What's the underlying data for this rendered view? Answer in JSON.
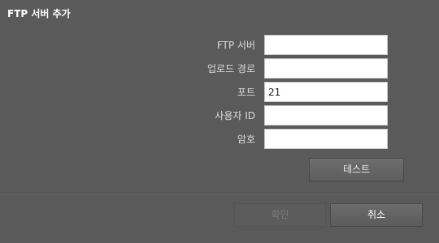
{
  "dialog": {
    "title": "FTP 서버 추가"
  },
  "form": {
    "server_label": "FTP 서버",
    "server_value": "",
    "upload_path_label": "업로드 경로",
    "upload_path_value": "",
    "port_label": "포트",
    "port_value": "21",
    "user_id_label": "사용자 ID",
    "user_id_value": "",
    "password_label": "암호",
    "password_value": ""
  },
  "buttons": {
    "test_label": "테스트",
    "ok_label": "확인",
    "ok_enabled": false,
    "cancel_label": "취소"
  },
  "colors": {
    "background": "#5a5a5a",
    "field_background": "#ffffff",
    "label_text": "#dcdcdc",
    "disabled_text": "#7a7a7a"
  }
}
